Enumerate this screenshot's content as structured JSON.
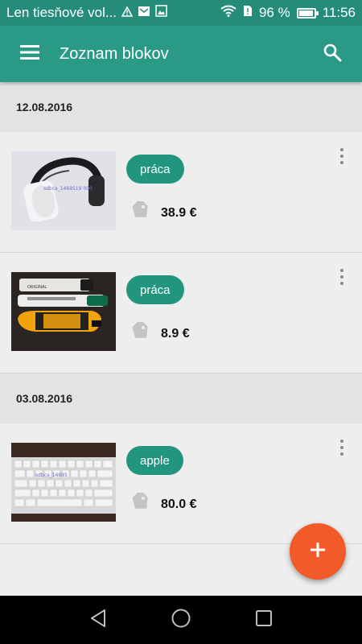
{
  "status_bar": {
    "notification": "Len tiesňové vol...",
    "battery": "96 %",
    "battery_level": 0.96,
    "time": "11:56",
    "icons": [
      "warning-icon",
      "mail-icon",
      "image-icon",
      "wifi-icon",
      "sim-icon",
      "battery-icon"
    ]
  },
  "app_bar": {
    "title": "Zoznam blokov",
    "menu_icon": "menu-icon",
    "search_icon": "search-icon"
  },
  "groups": [
    {
      "date": "12.08.2016",
      "items": [
        {
          "thumbnail": "headphones",
          "tag": "práca",
          "price": "38.9 €"
        },
        {
          "thumbnail": "markers",
          "tag": "práca",
          "price": "8.9 €"
        }
      ]
    },
    {
      "date": "03.08.2016",
      "items": [
        {
          "thumbnail": "keyboard",
          "tag": "apple",
          "price": "80.0 €"
        }
      ]
    }
  ],
  "colors": {
    "status_bar": "#268c7a",
    "app_bar": "#2a9a86",
    "tag": "#22957f",
    "fab": "#f25a2a",
    "date_header": "#e3e3e3",
    "background": "#eeeeee"
  },
  "fab": {
    "icon": "plus-icon"
  },
  "nav_bar": {
    "icons": [
      "back-icon",
      "home-icon",
      "recents-icon"
    ]
  }
}
